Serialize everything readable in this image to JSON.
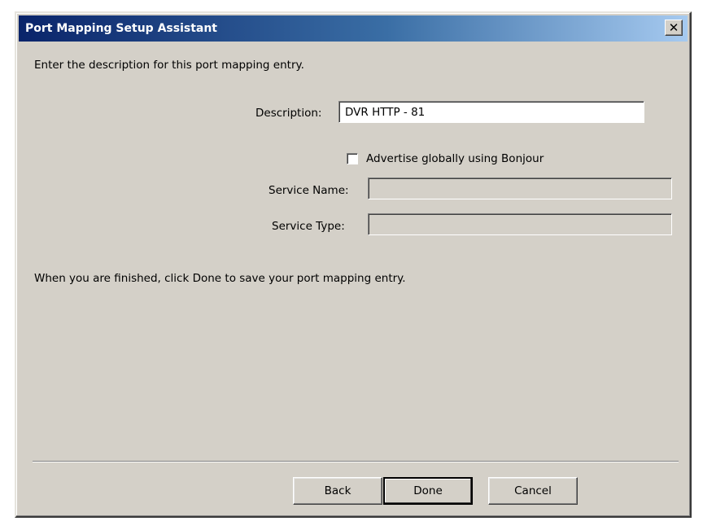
{
  "window": {
    "title": "Port Mapping Setup Assistant",
    "close_glyph": "✕"
  },
  "intro_text": "Enter the description for this port mapping entry.",
  "form": {
    "description_label": "Description:",
    "description_value": "DVR HTTP - 81",
    "advertise_label": "Advertise globally using Bonjour",
    "advertise_checked": false,
    "service_name_label": "Service Name:",
    "service_name_value": "",
    "service_type_label": "Service Type:",
    "service_type_value": ""
  },
  "finish_text": "When you are finished, click Done to save your port mapping entry.",
  "buttons": {
    "back": "Back",
    "done": "Done",
    "cancel": "Cancel"
  }
}
